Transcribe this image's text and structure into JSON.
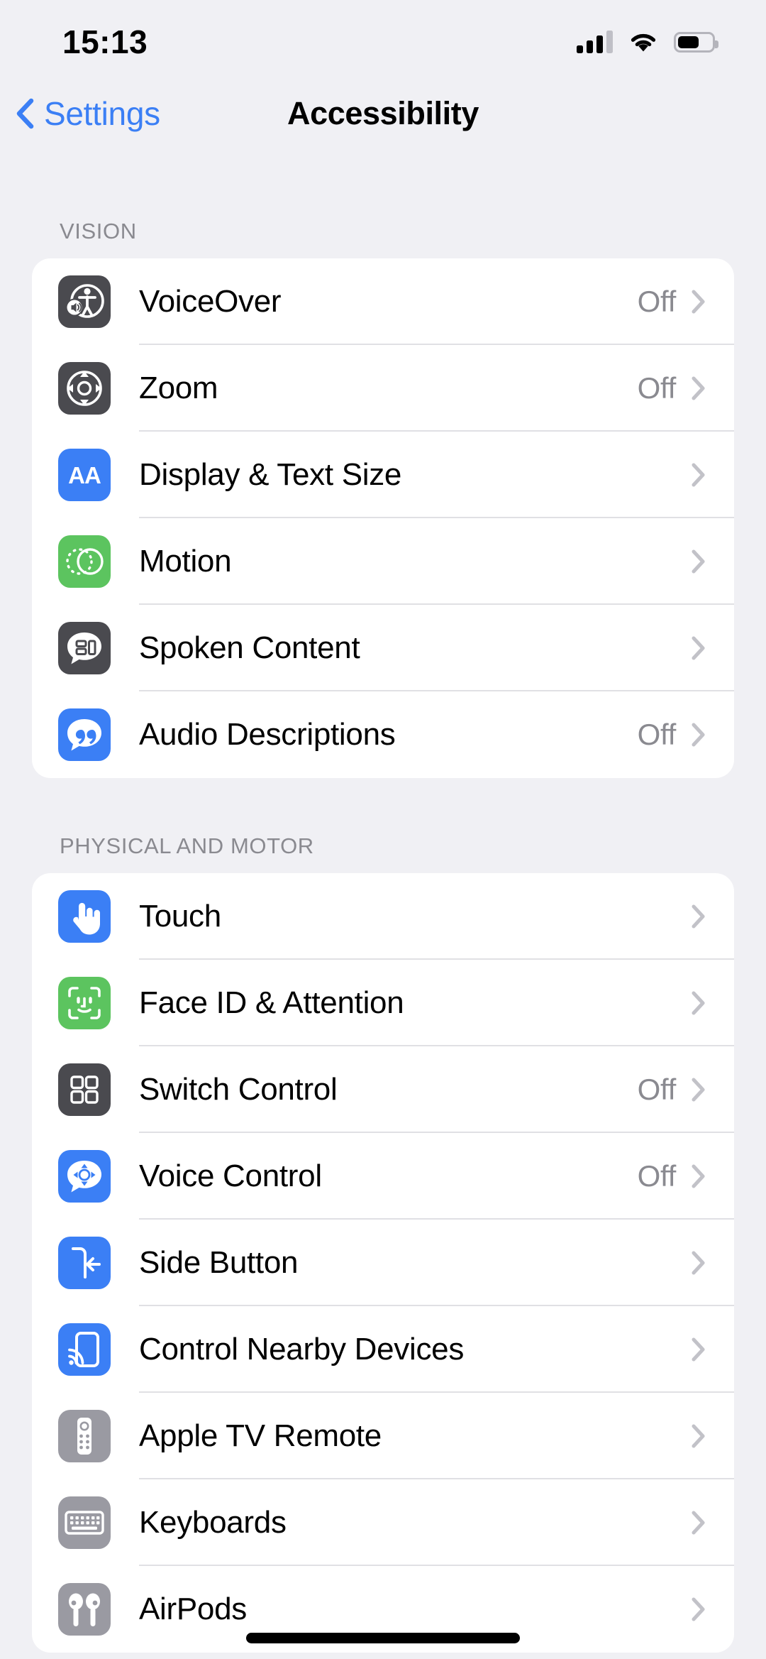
{
  "status_bar": {
    "time": "15:13",
    "cellular_icon": "cellular-signal-icon",
    "cellular_bars_filled": 3,
    "cellular_bars_total": 4,
    "wifi_icon": "wifi-icon",
    "battery_icon": "battery-icon",
    "battery_level_percent": 62
  },
  "nav": {
    "back_label": "Settings",
    "back_icon": "chevron-left-icon",
    "title": "Accessibility"
  },
  "colors": {
    "accent_blue": "#3b7ff5",
    "icon_dark": "#4a4a4f",
    "icon_green": "#5cc45f",
    "icon_gray": "#9a9aa2",
    "value_gray": "#8a8a90",
    "page_background": "#f0f0f4",
    "card_background": "#ffffff"
  },
  "sections": [
    {
      "header": "VISION",
      "rows": [
        {
          "label": "VoiceOver",
          "value": "Off",
          "icon": "voiceover-icon",
          "icon_style": "dark",
          "chevron": "chevron-right-icon"
        },
        {
          "label": "Zoom",
          "value": "Off",
          "icon": "zoom-icon",
          "icon_style": "dark",
          "chevron": "chevron-right-icon"
        },
        {
          "label": "Display & Text Size",
          "value": "",
          "icon": "display-text-size-icon",
          "icon_style": "blue",
          "chevron": "chevron-right-icon"
        },
        {
          "label": "Motion",
          "value": "",
          "icon": "motion-icon",
          "icon_style": "green",
          "chevron": "chevron-right-icon"
        },
        {
          "label": "Spoken Content",
          "value": "",
          "icon": "spoken-content-icon",
          "icon_style": "dark",
          "chevron": "chevron-right-icon"
        },
        {
          "label": "Audio Descriptions",
          "value": "Off",
          "icon": "audio-descriptions-icon",
          "icon_style": "blue",
          "chevron": "chevron-right-icon"
        }
      ]
    },
    {
      "header": "PHYSICAL AND MOTOR",
      "rows": [
        {
          "label": "Touch",
          "value": "",
          "icon": "touch-icon",
          "icon_style": "blue",
          "chevron": "chevron-right-icon"
        },
        {
          "label": "Face ID & Attention",
          "value": "",
          "icon": "face-id-icon",
          "icon_style": "green",
          "chevron": "chevron-right-icon"
        },
        {
          "label": "Switch Control",
          "value": "Off",
          "icon": "switch-control-icon",
          "icon_style": "dark",
          "chevron": "chevron-right-icon"
        },
        {
          "label": "Voice Control",
          "value": "Off",
          "icon": "voice-control-icon",
          "icon_style": "blue",
          "chevron": "chevron-right-icon"
        },
        {
          "label": "Side Button",
          "value": "",
          "icon": "side-button-icon",
          "icon_style": "blue",
          "chevron": "chevron-right-icon"
        },
        {
          "label": "Control Nearby Devices",
          "value": "",
          "icon": "nearby-devices-icon",
          "icon_style": "blue",
          "chevron": "chevron-right-icon"
        },
        {
          "label": "Apple TV Remote",
          "value": "",
          "icon": "apple-tv-remote-icon",
          "icon_style": "gray",
          "chevron": "chevron-right-icon"
        },
        {
          "label": "Keyboards",
          "value": "",
          "icon": "keyboard-icon",
          "icon_style": "gray",
          "chevron": "chevron-right-icon"
        },
        {
          "label": "AirPods",
          "value": "",
          "icon": "airpods-icon",
          "icon_style": "gray",
          "chevron": "chevron-right-icon"
        }
      ]
    }
  ]
}
